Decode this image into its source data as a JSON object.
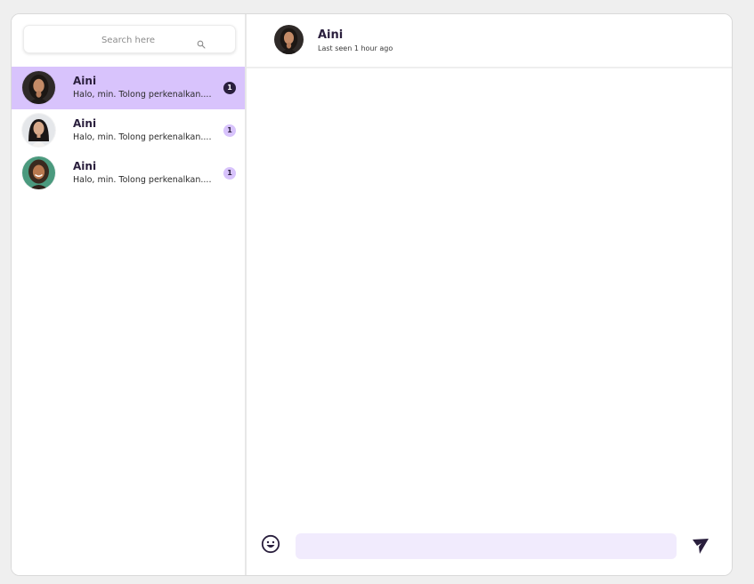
{
  "colors": {
    "accent": "#d8c3fc",
    "accent_dark": "#2a1f3d",
    "input_bg": "#f1ebfd"
  },
  "search": {
    "placeholder": "Search here",
    "icon": "search-icon"
  },
  "chats": [
    {
      "name": "Aini",
      "preview": "Halo, min. Tolong perkenalkan....",
      "unread": "1",
      "active": true
    },
    {
      "name": "Aini",
      "preview": "Halo, min. Tolong perkenalkan....",
      "unread": "1",
      "active": false
    },
    {
      "name": "Aini",
      "preview": "Halo, min. Tolong perkenalkan....",
      "unread": "1",
      "active": false
    }
  ],
  "header": {
    "name": "Aini",
    "status": "Last seen 1 hour ago"
  },
  "composer": {
    "emoji_icon": "smiley-icon",
    "send_icon": "send-icon",
    "value": ""
  }
}
